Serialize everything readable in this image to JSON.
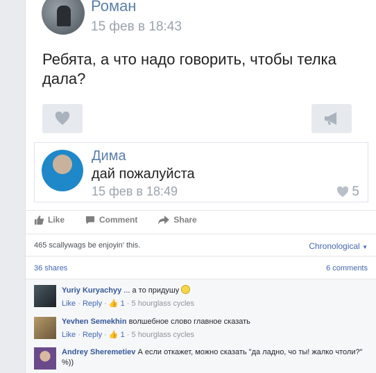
{
  "vk_post": {
    "author": "Роман",
    "date": "15 фев в 18:43",
    "text": "Ребята, а что надо говорить, чтобы телка дала?",
    "comment": {
      "author": "Дима",
      "text": "дай пожалуйста",
      "date": "15 фев в 18:49",
      "likes": "5"
    }
  },
  "actions": {
    "like": "Like",
    "comment": "Comment",
    "share": "Share"
  },
  "summary": {
    "likes_text": "465 scallywags be enjoyin' this.",
    "sort_label": "Chronological",
    "shares": "36 shares",
    "comments_count": "6 comments"
  },
  "comments": [
    {
      "author": "Yuriy Kuryachyy",
      "text": "... а то придушу",
      "like": "Like",
      "reply": "Reply",
      "likes": "1",
      "time": "5 hourglass cycles"
    },
    {
      "author": "Yevhen Semekhin",
      "text": "волшебное слово главное сказать",
      "like": "Like",
      "reply": "Reply",
      "likes": "1",
      "time": "5 hourglass cycles"
    },
    {
      "author": "Andrey Sheremetiev",
      "text": "А если откажет, можно сказать \"да ладно, чо ты! жалко чтоли?\" %))"
    }
  ]
}
